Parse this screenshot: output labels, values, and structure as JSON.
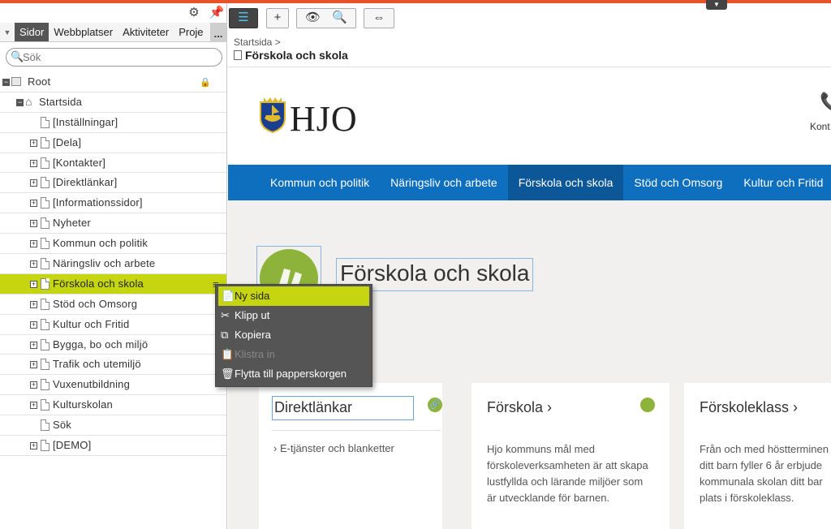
{
  "tabs": [
    "Sidor",
    "Webbplatser",
    "Aktiviteter",
    "Proje"
  ],
  "tabs_more": "...",
  "search": {
    "placeholder": "Sök"
  },
  "tree": {
    "root": "Root",
    "start": "Startsida",
    "items": [
      "[Inställningar]",
      "[Dela]",
      "[Kontakter]",
      "[Direktlänkar]",
      "[Informationssidor]",
      "Nyheter",
      "Kommun och politik",
      "Näringsliv och arbete",
      "Förskola och skola",
      "Stöd och Omsorg",
      "Kultur och Fritid",
      "Bygga, bo och miljö",
      "Trafik och utemiljö",
      "Vuxenutbildning",
      "Kulturskolan",
      "Sök",
      "[DEMO]"
    ]
  },
  "context_menu": {
    "items": [
      "Ny sida",
      "Klipp ut",
      "Kopiera",
      "Klistra in",
      "Flytta till papperskorgen"
    ]
  },
  "breadcrumb": {
    "parent": "Startsida",
    "sep": ">",
    "current": "Förskola och skola"
  },
  "site": {
    "brand": "HJO",
    "contact": "Kont",
    "nav": [
      "Kommun och politik",
      "Näringsliv och arbete",
      "Förskola och skola",
      "Stöd och Omsorg",
      "Kultur och Fritid"
    ],
    "hero_title": "Förskola och skola",
    "cards": {
      "direct_title": "Direktlänkar",
      "direct_link": "E-tjänster och blanketter",
      "preschool_title": "Förskola",
      "preschool_text": "Hjo kommuns mål med förskoleverksamheten är att skapa lustfyllda och lärande miljöer som är utvecklande för barnen.",
      "preschoolclass_title": "Förskoleklass",
      "preschoolclass_text": "Från och med höstterminen ditt barn fyller 6 år erbjude kommunala skolan ditt bar plats i förskoleklass."
    }
  },
  "colors": {
    "accent": "#c5d611",
    "nav": "#0f6fbf",
    "top_bar": "#e8542a",
    "green": "#8db33a"
  }
}
